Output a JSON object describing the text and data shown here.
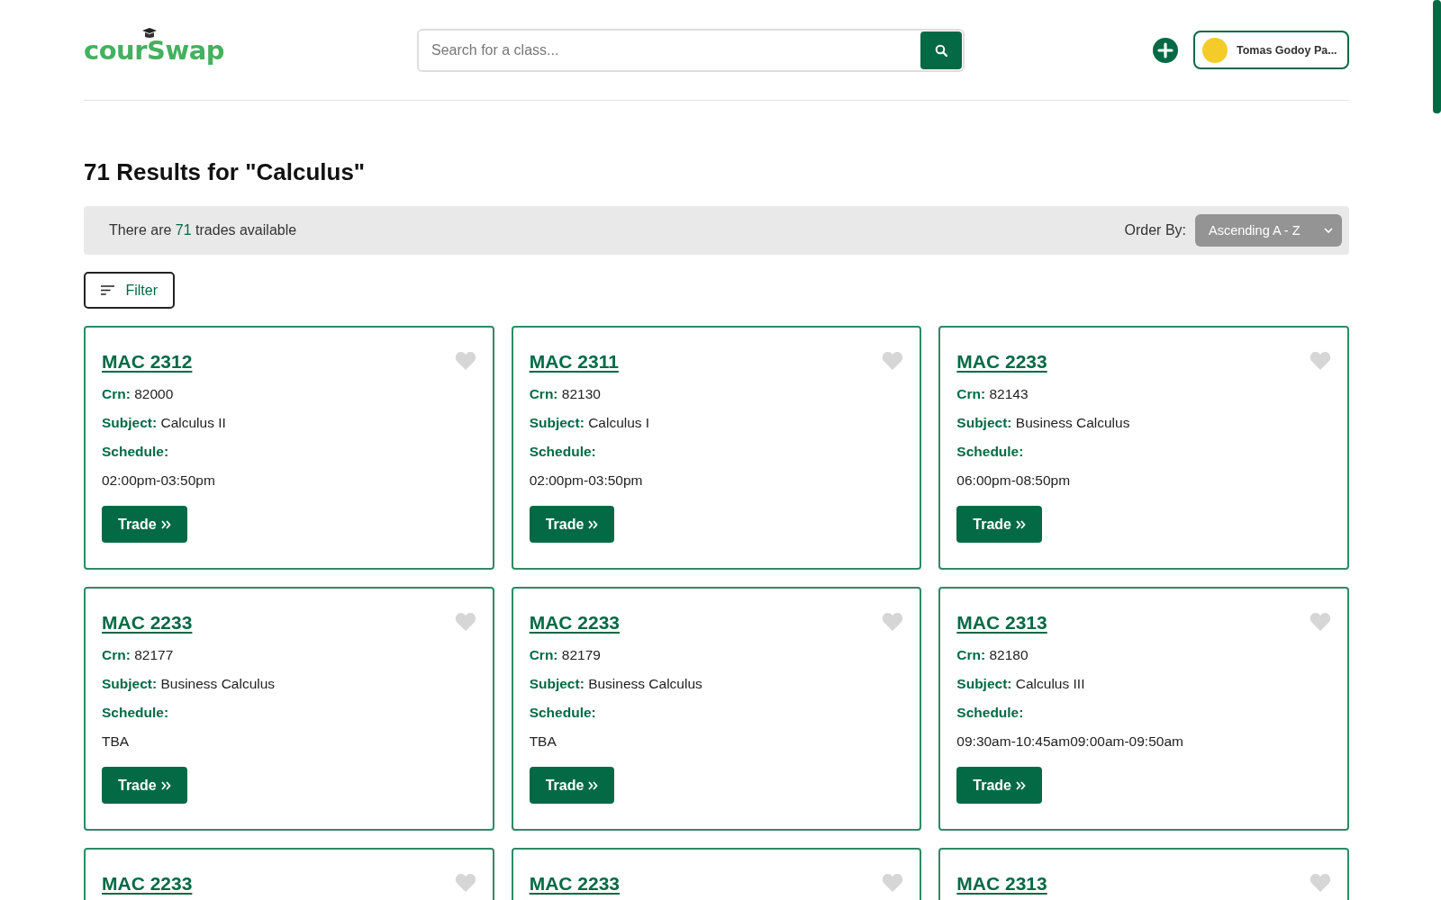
{
  "header": {
    "logo": "courSwap",
    "search": {
      "placeholder": "Search for a class..."
    },
    "user": {
      "name": "Tomas Godoy Pa..."
    }
  },
  "heading": "71 Results for \"Calculus\"",
  "info_bar": {
    "before": "There are ",
    "count": "71",
    "after": " trades available",
    "order_label": "Order By:",
    "order_value": "Ascending A - Z"
  },
  "filter_button": "Filter",
  "cards": [
    {
      "code": "MAC 2312",
      "favorite": false,
      "crn_label": "Crn:",
      "crn": "82000",
      "subject_label": "Subject:",
      "subject": "Calculus II",
      "schedule_label": "Schedule:",
      "schedule": "02:00pm-03:50pm",
      "button": "Trade"
    },
    {
      "code": "MAC 2311",
      "favorite": false,
      "crn_label": "Crn:",
      "crn": "82130",
      "subject_label": "Subject:",
      "subject": "Calculus I",
      "schedule_label": "Schedule:",
      "schedule": "02:00pm-03:50pm",
      "button": "Trade"
    },
    {
      "code": "MAC 2233",
      "favorite": false,
      "crn_label": "Crn:",
      "crn": "82143",
      "subject_label": "Subject:",
      "subject": "Business Calculus",
      "schedule_label": "Schedule:",
      "schedule": "06:00pm-08:50pm",
      "button": "Trade"
    },
    {
      "code": "MAC 2233",
      "favorite": false,
      "crn_label": "Crn:",
      "crn": "82177",
      "subject_label": "Subject:",
      "subject": "Business Calculus",
      "schedule_label": "Schedule:",
      "schedule": "TBA",
      "button": "Trade"
    },
    {
      "code": "MAC 2233",
      "favorite": false,
      "crn_label": "Crn:",
      "crn": "82179",
      "subject_label": "Subject:",
      "subject": "Business Calculus",
      "schedule_label": "Schedule:",
      "schedule": "TBA",
      "button": "Trade"
    },
    {
      "code": "MAC 2313",
      "favorite": false,
      "crn_label": "Crn:",
      "crn": "82180",
      "subject_label": "Subject:",
      "subject": "Calculus III",
      "schedule_label": "Schedule:",
      "schedule": "09:30am-10:45am09:00am-09:50am",
      "button": "Trade"
    },
    {
      "code": "MAC 2233",
      "favorite": false
    },
    {
      "code": "MAC 2233",
      "favorite": false
    },
    {
      "code": "MAC 2313",
      "favorite": false
    }
  ]
}
